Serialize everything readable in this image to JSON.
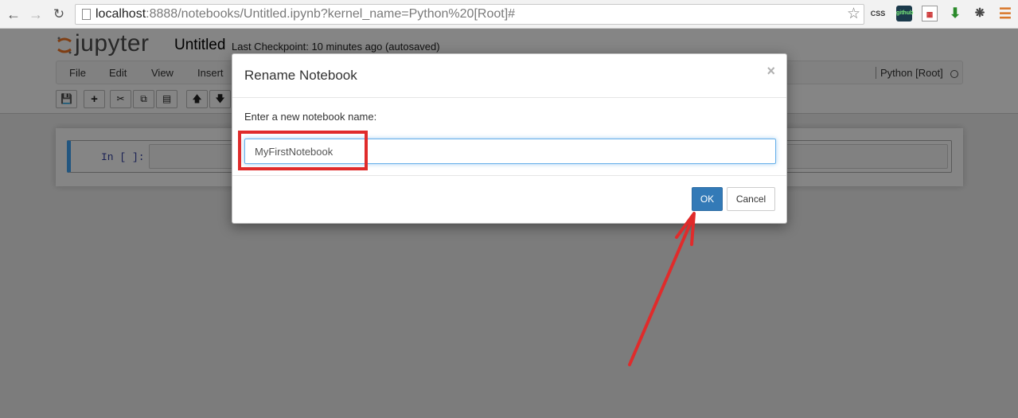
{
  "browser": {
    "url_host": "localhost",
    "url_rest": ":8888/notebooks/Untitled.ipynb?kernel_name=Python%20[Root]#",
    "back_icon": "arrow-left-icon",
    "forward_icon": "arrow-right-icon",
    "reload_icon": "reload-icon",
    "bookmark_icon": "star-icon",
    "extensions": {
      "css_label": "CSS",
      "git_label": "github"
    }
  },
  "jupyter": {
    "logo_text": "jupyter",
    "notebook_title": "Untitled",
    "checkpoint": "Last Checkpoint: 10 minutes ago (autosaved)",
    "menu": [
      "File",
      "Edit",
      "View",
      "Insert"
    ],
    "kernel": "Python [Root]",
    "cell_prompt": "In [ ]:"
  },
  "modal": {
    "title": "Rename Notebook",
    "close_glyph": "×",
    "prompt": "Enter a new notebook name:",
    "input_value": "MyFirstNotebook",
    "ok_label": "OK",
    "cancel_label": "Cancel",
    "primary_color": "#337ab7"
  },
  "annotation": {
    "color": "#e02b2b"
  }
}
